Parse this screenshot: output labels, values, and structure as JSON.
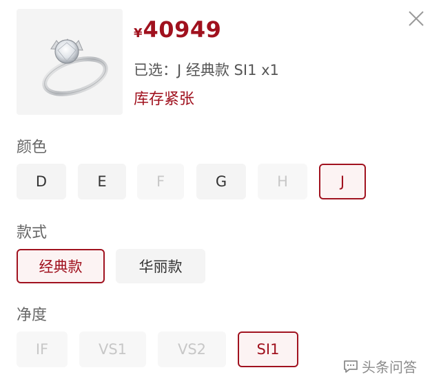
{
  "product": {
    "currency_symbol": "¥",
    "price": "40949",
    "selected_text": "已选：J 经典款 SI1 x1",
    "stock_status": "库存紧张",
    "image_icon": "diamond-ring-icon"
  },
  "close_icon": "close-icon",
  "sections": {
    "color": {
      "label": "颜色",
      "options": [
        "D",
        "E",
        "F",
        "G",
        "H",
        "J"
      ],
      "disabled": [
        "F",
        "H"
      ],
      "selected": "J"
    },
    "style": {
      "label": "款式",
      "options": [
        "经典款",
        "华丽款"
      ],
      "selected": "经典款"
    },
    "clarity": {
      "label": "净度",
      "options": [
        "IF",
        "VS1",
        "VS2",
        "SI1"
      ],
      "disabled": [
        "IF",
        "VS1",
        "VS2"
      ],
      "selected": "SI1"
    }
  },
  "watermark": {
    "text": "头条问答",
    "icon": "speech-bubble-icon"
  },
  "colors": {
    "accent": "#a0111e",
    "option_bg": "#f4f4f4",
    "disabled_text": "#c7c7c7",
    "selected_bg": "#fcf3f3"
  }
}
